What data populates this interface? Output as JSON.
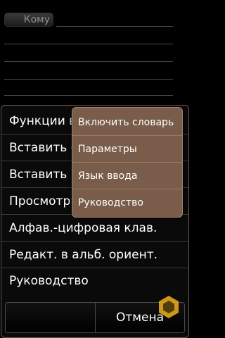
{
  "compose": {
    "to_label": "Кому"
  },
  "menu": {
    "items": [
      {
        "label": "Функции ввода"
      },
      {
        "label": "Вставить смайлик"
      },
      {
        "label": "Вставить значок"
      },
      {
        "label": "Просмотр в полн. экр."
      },
      {
        "label": "Алфав.-цифровая клав."
      },
      {
        "label": "Редакт. в альб. ориент."
      },
      {
        "label": "Руководство"
      }
    ]
  },
  "submenu": {
    "items": [
      {
        "label": "Включить словарь"
      },
      {
        "label": "Параметры"
      },
      {
        "label": "Язык ввода"
      },
      {
        "label": "Руководство"
      }
    ]
  },
  "softkeys": {
    "left_label": "",
    "right_label": "Отмена"
  },
  "colors": {
    "menu_border": "#6e5648",
    "submenu_bg": "#7a5c4a",
    "watermark": "#f0b020"
  }
}
